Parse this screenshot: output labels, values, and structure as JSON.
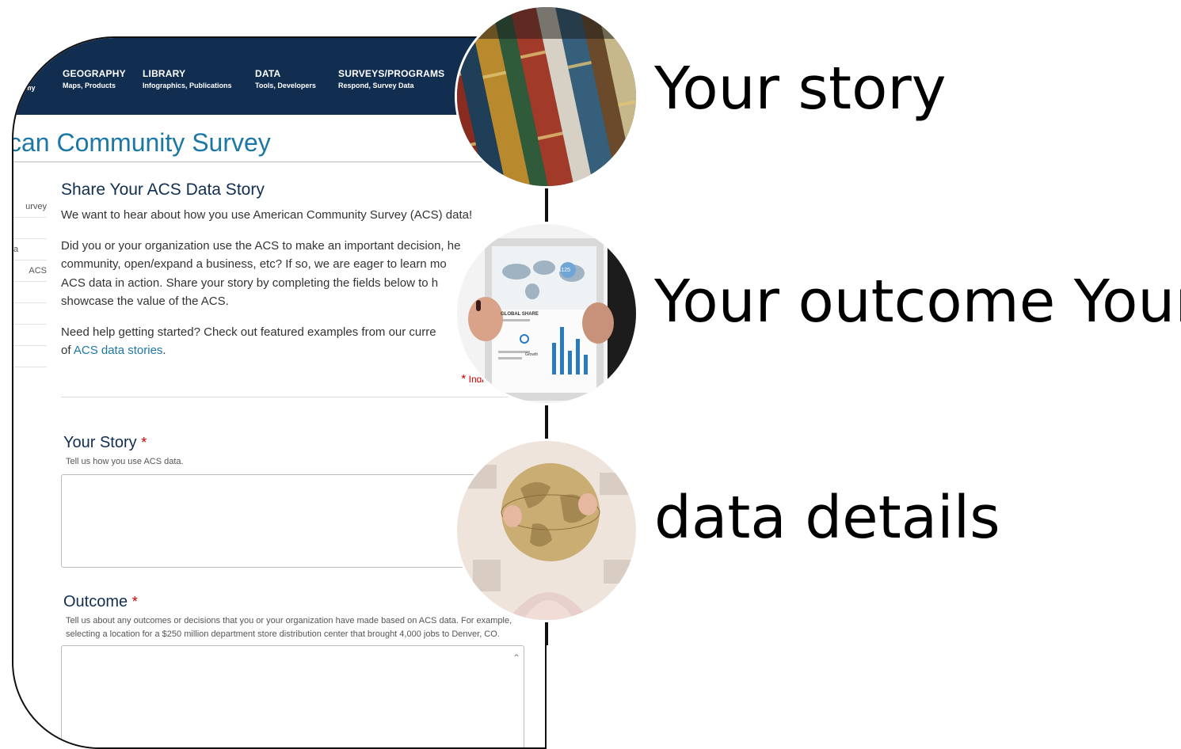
{
  "nav": {
    "partial_item": "onomy",
    "items": [
      {
        "title": "GEOGRAPHY",
        "sub": "Maps, Products"
      },
      {
        "title": "LIBRARY",
        "sub": "Infographics, Publications"
      },
      {
        "title": "DATA",
        "sub": "Tools, Developers"
      },
      {
        "title": "SURVEYS/PROGRAMS",
        "sub": "Respond, Survey Data"
      }
    ]
  },
  "page_title": "can Community Survey",
  "sidenav": [
    "urvey",
    "",
    "a",
    "ACS",
    "",
    "",
    "",
    ""
  ],
  "main": {
    "heading": "Share Your ACS Data Story",
    "intro": "We want to hear about how you use American Community Survey (ACS) data!",
    "para2_lines": [
      "Did you or your organization use the ACS to make an important decision, he",
      "community, open/expand a business, etc? If so, we are eager to learn mo",
      "ACS data in action. Share your story by completing the fields below to h",
      "showcase the value of the ACS."
    ],
    "para3_line1": "Need help getting started? Check out featured examples from our curre",
    "para3_prefix": "of ",
    "para3_link": "ACS data stories",
    "para3_suffix": ".",
    "required_star": "*",
    "required_note": "Indicates a requ"
  },
  "fields": {
    "story": {
      "label": "Your Story",
      "star": "*",
      "help": "Tell us how you use ACS data."
    },
    "outcome": {
      "label": "Outcome",
      "star": "*",
      "help_line1": "Tell us about any outcomes or decisions that you or your organization have made based on ACS data. For example,",
      "help_line2": "selecting a location for a $250 million department store distribution center that brought 4,000 jobs to Denver, CO."
    }
  },
  "tablet": {
    "badge": "1125",
    "panel_title": "GLOBAL SHARE",
    "panel_sub": "Growth"
  },
  "captions": {
    "story": "Your story",
    "outcome": "Your outcome  Your",
    "details": "data details"
  }
}
